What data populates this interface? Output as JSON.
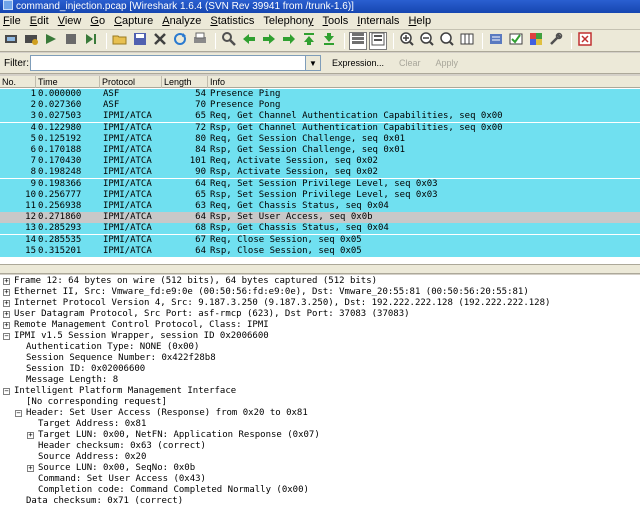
{
  "window": {
    "title": "command_injection.pcap  [Wireshark 1.6.4  (SVN Rev 39941 from /trunk-1.6)]"
  },
  "menu": [
    {
      "label": "File",
      "u": "F"
    },
    {
      "label": "Edit",
      "u": "E"
    },
    {
      "label": "View",
      "u": "V"
    },
    {
      "label": "Go",
      "u": "G"
    },
    {
      "label": "Capture",
      "u": "C"
    },
    {
      "label": "Analyze",
      "u": "A"
    },
    {
      "label": "Statistics",
      "u": "S"
    },
    {
      "label": "Telephony",
      "u": "y"
    },
    {
      "label": "Tools",
      "u": "T"
    },
    {
      "label": "Internals",
      "u": "I"
    },
    {
      "label": "Help",
      "u": "H"
    }
  ],
  "toolbar": {
    "icons": [
      "interface-list-icon",
      "capture-options-icon",
      "start-capture-icon",
      "stop-capture-icon",
      "restart-capture-icon",
      "open-file-icon",
      "save-file-icon",
      "close-file-icon",
      "reload-icon",
      "print-icon",
      "find-packet-icon",
      "go-back-icon",
      "go-forward-icon",
      "go-to-packet-icon",
      "go-first-icon",
      "go-last-icon",
      "colorize-icon",
      "auto-scroll-icon",
      "zoom-in-icon",
      "zoom-out-icon",
      "zoom-normal-icon",
      "resize-columns-icon",
      "capture-filters-icon",
      "display-filters-icon",
      "coloring-rules-icon",
      "preferences-icon",
      "help-icon"
    ]
  },
  "filter": {
    "label": "Filter:",
    "value": "",
    "expression_label": "Expression...",
    "clear_label": "Clear",
    "apply_label": "Apply"
  },
  "columns": [
    "No.",
    "Time",
    "Protocol",
    "Length",
    "Info"
  ],
  "packets": [
    {
      "no": "1",
      "time": "0.000000",
      "protocol": "ASF",
      "length": "54",
      "info": "Presence Ping"
    },
    {
      "no": "2",
      "time": "0.027360",
      "protocol": "ASF",
      "length": "70",
      "info": "Presence Pong"
    },
    {
      "no": "3",
      "time": "0.027503",
      "protocol": "IPMI/ATCA",
      "length": "65",
      "info": "Req, Get Channel Authentication Capabilities, seq 0x00"
    },
    {
      "no": "4",
      "time": "0.122980",
      "protocol": "IPMI/ATCA",
      "length": "72",
      "info": "Rsp, Get Channel Authentication Capabilities, seq 0x00"
    },
    {
      "no": "5",
      "time": "0.125192",
      "protocol": "IPMI/ATCA",
      "length": "80",
      "info": "Req, Get Session Challenge, seq 0x01"
    },
    {
      "no": "6",
      "time": "0.170188",
      "protocol": "IPMI/ATCA",
      "length": "84",
      "info": "Rsp, Get Session Challenge, seq 0x01"
    },
    {
      "no": "7",
      "time": "0.170430",
      "protocol": "IPMI/ATCA",
      "length": "101",
      "info": "Req, Activate Session, seq 0x02"
    },
    {
      "no": "8",
      "time": "0.198248",
      "protocol": "IPMI/ATCA",
      "length": "90",
      "info": "Rsp, Activate Session, seq 0x02"
    },
    {
      "no": "9",
      "time": "0.198366",
      "protocol": "IPMI/ATCA",
      "length": "64",
      "info": "Req, Set Session Privilege Level, seq 0x03"
    },
    {
      "no": "10",
      "time": "0.256777",
      "protocol": "IPMI/ATCA",
      "length": "65",
      "info": "Rsp, Set Session Privilege Level, seq 0x03"
    },
    {
      "no": "11",
      "time": "0.256938",
      "protocol": "IPMI/ATCA",
      "length": "63",
      "info": "Req, Get Chassis Status, seq 0x04"
    },
    {
      "no": "12",
      "time": "0.271860",
      "protocol": "IPMI/ATCA",
      "length": "64",
      "info": "Rsp, Set User Access, seq 0x0b",
      "selected": true
    },
    {
      "no": "13",
      "time": "0.285293",
      "protocol": "IPMI/ATCA",
      "length": "68",
      "info": "Rsp, Get Chassis Status, seq 0x04"
    },
    {
      "no": "14",
      "time": "0.285535",
      "protocol": "IPMI/ATCA",
      "length": "67",
      "info": "Req, Close Session, seq 0x05"
    },
    {
      "no": "15",
      "time": "0.315201",
      "protocol": "IPMI/ATCA",
      "length": "64",
      "info": "Rsp, Close Session, seq 0x05"
    }
  ],
  "details": [
    {
      "level": 0,
      "expander": "+",
      "text": "Frame 12: 64 bytes on wire (512 bits), 64 bytes captured (512 bits)"
    },
    {
      "level": 0,
      "expander": "+",
      "text": "Ethernet II, Src: Vmware_fd:e9:0e (00:50:56:fd:e9:0e), Dst: Vmware_20:55:81 (00:50:56:20:55:81)"
    },
    {
      "level": 0,
      "expander": "+",
      "text": "Internet Protocol Version 4, Src: 9.187.3.250 (9.187.3.250), Dst: 192.222.222.128 (192.222.222.128)"
    },
    {
      "level": 0,
      "expander": "+",
      "text": "User Datagram Protocol, Src Port: asf-rmcp (623), Dst Port: 37083 (37083)"
    },
    {
      "level": 0,
      "expander": "+",
      "text": "Remote Management Control Protocol, Class: IPMI"
    },
    {
      "level": 0,
      "expander": "-",
      "text": "IPMI v1.5 Session Wrapper, session ID 0x2006600"
    },
    {
      "level": 1,
      "expander": "",
      "text": "Authentication Type: NONE (0x00)"
    },
    {
      "level": 1,
      "expander": "",
      "text": "Session Sequence Number: 0x422f28b8"
    },
    {
      "level": 1,
      "expander": "",
      "text": "Session ID: 0x02006600"
    },
    {
      "level": 1,
      "expander": "",
      "text": "Message Length: 8"
    },
    {
      "level": 0,
      "expander": "-",
      "text": "Intelligent Platform Management Interface"
    },
    {
      "level": 1,
      "expander": "",
      "text": "[No corresponding request]"
    },
    {
      "level": 1,
      "expander": "-",
      "text": "Header: Set User Access (Response) from 0x20 to 0x81"
    },
    {
      "level": 2,
      "expander": "",
      "text": "Target Address: 0x81"
    },
    {
      "level": 2,
      "expander": "+",
      "text": "Target LUN: 0x00, NetFN: Application Response (0x07)"
    },
    {
      "level": 2,
      "expander": "",
      "text": "Header checksum: 0x63 (correct)"
    },
    {
      "level": 2,
      "expander": "",
      "text": "Source Address: 0x20"
    },
    {
      "level": 2,
      "expander": "+",
      "text": "Source LUN: 0x00, SeqNo: 0x0b"
    },
    {
      "level": 2,
      "expander": "",
      "text": "Command: Set User Access (0x43)"
    },
    {
      "level": 2,
      "expander": "",
      "text": "Completion code: Command Completed Normally (0x00)"
    },
    {
      "level": 1,
      "expander": "",
      "text": "Data checksum: 0x71 (correct)"
    }
  ],
  "colors": {
    "row_ipmi": "#70e0f0",
    "row_selected": "#c8c8c8",
    "titlebar": "#1646b0"
  }
}
